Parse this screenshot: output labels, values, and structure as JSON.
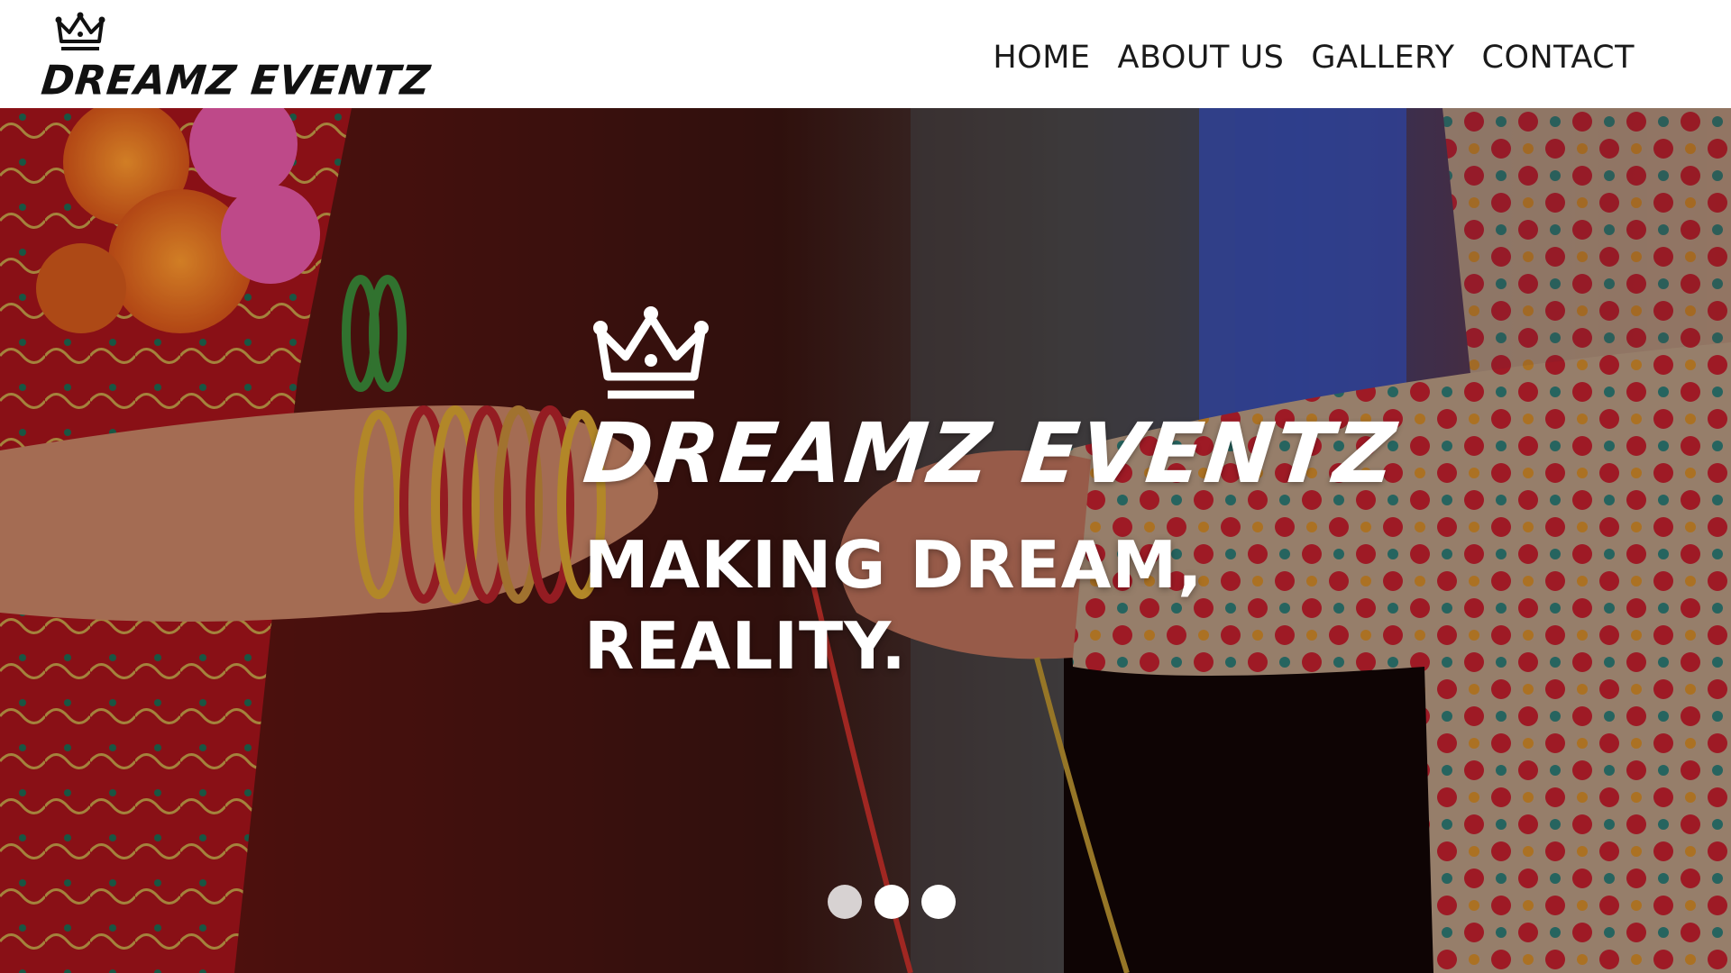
{
  "header": {
    "logo": {
      "text": "DREAMZ EVENTZ",
      "icon": "crown-icon"
    },
    "nav": [
      {
        "label": "HOME"
      },
      {
        "label": "ABOUT US"
      },
      {
        "label": "GALLERY"
      },
      {
        "label": "CONTACT"
      }
    ]
  },
  "hero": {
    "brand": {
      "text": "DREAMZ EVENTZ",
      "icon": "crown-icon"
    },
    "tagline_line1": "MAKING DREAM,",
    "tagline_line2": "REALITY.",
    "slider": {
      "slide_count": 3,
      "active_index": 0
    }
  },
  "colors": {
    "header_bg": "#ffffff",
    "nav_text": "#1a1a1a",
    "hero_text": "#ffffff",
    "dot_active": "#ffffff",
    "dot_inactive": "#d7d2d2"
  }
}
